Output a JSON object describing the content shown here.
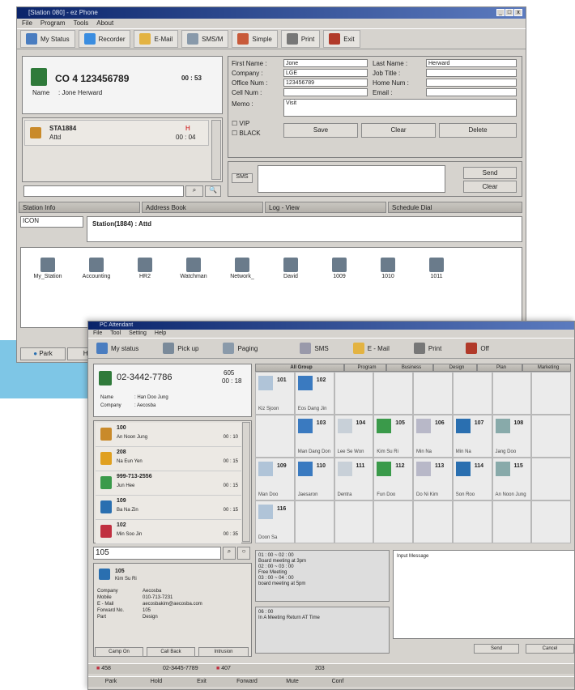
{
  "w1": {
    "title": "[Station 080] - ez Phone",
    "menu": [
      "File",
      "Program",
      "Tools",
      "About"
    ],
    "toolbar": [
      "My Status",
      "Recorder",
      "E-Mail",
      "SMS/M",
      "Simple",
      "Print",
      "Exit"
    ],
    "call": {
      "line": "CO  4 123456789",
      "time": "00 : 53",
      "name_label": "Name",
      "name": ": Jone Herward"
    },
    "station": {
      "name": "STA1884",
      "status": "Attd",
      "h": "H",
      "time": "00 : 04"
    },
    "form": {
      "first_label": "First Name :",
      "first": "Jone",
      "last_label": "Last Name :",
      "last": "Herward",
      "company_label": "Company  :",
      "company": "LGE",
      "job_label": "Job Title   :",
      "office_label": "Office Num :",
      "office": "123456789",
      "home_label": "Home Num :",
      "cell_label": "Cell Num   :",
      "email_label": "Email      :",
      "memo_label": "Memo       :",
      "memo": "Visit",
      "vip": "VIP",
      "black": "BLACK",
      "save": "Save",
      "clear": "Clear",
      "delete": "Delete"
    },
    "sms_label": "SMS",
    "send": "Send",
    "clear2": "Clear",
    "tabs": [
      "Station Info",
      "Address Book",
      "Log - View",
      "Schedule Dial"
    ],
    "view": "ICON",
    "station_line": "Station(1884) : Attd",
    "stations": [
      "My_Station",
      "Accounting",
      "HR2",
      "Watchman",
      "Network_",
      "David",
      "1009",
      "1010",
      "1011"
    ],
    "bottom": [
      "Park",
      "Hold"
    ]
  },
  "w2": {
    "title": "PC Attendant",
    "menu": [
      "File",
      "Tool",
      "Setting",
      "Help"
    ],
    "toolbar": [
      "My status",
      "Pick up",
      "Paging",
      "SMS",
      "E - Mail",
      "Print",
      "Off"
    ],
    "call": {
      "number": "02-3442-7786",
      "ext": "605",
      "time": "00 : 18",
      "name_label": "Name",
      "name": ": Han Doo Jung",
      "company_label": "Company",
      "company": ": Aecosba"
    },
    "list": [
      {
        "a": "100",
        "b": "An Noon Jung",
        "t": "00 : 10"
      },
      {
        "a": "208",
        "b": "Na Eun Yen",
        "t": "00 : 15"
      },
      {
        "a": "999-713-2556",
        "b": "Jun Hee",
        "t": "00 : 15"
      },
      {
        "a": "109",
        "b": "Ba Na Zin",
        "t": "00 : 15"
      },
      {
        "a": "102",
        "b": "Min Soo Jin",
        "t": "00 : 35"
      }
    ],
    "groups": [
      "All Group",
      "Program",
      "Business",
      "Design",
      "Plan",
      "Marketing"
    ],
    "cells": [
      {
        "n": "101",
        "nm": "Kiz Sjoon"
      },
      {
        "n": "102",
        "nm": "Eos Dang Jin"
      },
      {
        "n": "",
        "nm": ""
      },
      {
        "n": "",
        "nm": ""
      },
      {
        "n": "",
        "nm": ""
      },
      {
        "n": "",
        "nm": ""
      },
      {
        "n": "",
        "nm": ""
      },
      {
        "n": "",
        "nm": ""
      },
      {
        "n": "",
        "nm": ""
      },
      {
        "n": "103",
        "nm": "Man Dang Don"
      },
      {
        "n": "104",
        "nm": "Lee Se Won"
      },
      {
        "n": "105",
        "nm": "Kim Su Ri"
      },
      {
        "n": "106",
        "nm": "Min Na"
      },
      {
        "n": "107",
        "nm": "Min Na"
      },
      {
        "n": "108",
        "nm": "Jang Doo"
      },
      {
        "n": "",
        "nm": ""
      },
      {
        "n": "109",
        "nm": "Man Doo"
      },
      {
        "n": "110",
        "nm": "Jaesaron"
      },
      {
        "n": "111",
        "nm": "Dentra"
      },
      {
        "n": "112",
        "nm": "Fun Doo"
      },
      {
        "n": "113",
        "nm": "Do Ni Kim"
      },
      {
        "n": "114",
        "nm": "Son Roo"
      },
      {
        "n": "115",
        "nm": "An Noon Jung"
      },
      {
        "n": "",
        "nm": ""
      },
      {
        "n": "116",
        "nm": "Doon Sa"
      },
      {
        "n": "",
        "nm": ""
      },
      {
        "n": "",
        "nm": ""
      },
      {
        "n": "",
        "nm": ""
      },
      {
        "n": "",
        "nm": ""
      },
      {
        "n": "",
        "nm": ""
      },
      {
        "n": "",
        "nm": ""
      },
      {
        "n": "",
        "nm": ""
      }
    ],
    "search": "105",
    "info": {
      "ext": "105",
      "name": "Kim Su Ri",
      "rows": [
        [
          "Company",
          "Aecosba"
        ],
        [
          "Mobile",
          "010-713-7231"
        ],
        [
          "E - Mail",
          "aecosbakim@aecosba.com"
        ],
        [
          "Forward No.",
          "105"
        ],
        [
          "Part",
          "Design"
        ]
      ]
    },
    "info_buttons": [
      "Camp On",
      "Call Back",
      "Intrusion"
    ],
    "memo1": "01 : 00 ~ 02 : 00\nBoard meeting at 3pm\n02 : 00 ~ 03 : 00\nFree Meeting\n03 : 00 ~ 04 : 00\nboard meeting at 5pm",
    "memo2": "06 : 00\nIn A Meeting Return AT Time",
    "input_label": "Input Message",
    "send": "Send",
    "cancel": "Cancel",
    "status": {
      "a": "458",
      "b": "02-3445-7789",
      "c": "407",
      "d": "203"
    },
    "bottom": [
      "Park",
      "Hold",
      "Exit",
      "Forward",
      "Mute",
      "Conf"
    ]
  }
}
